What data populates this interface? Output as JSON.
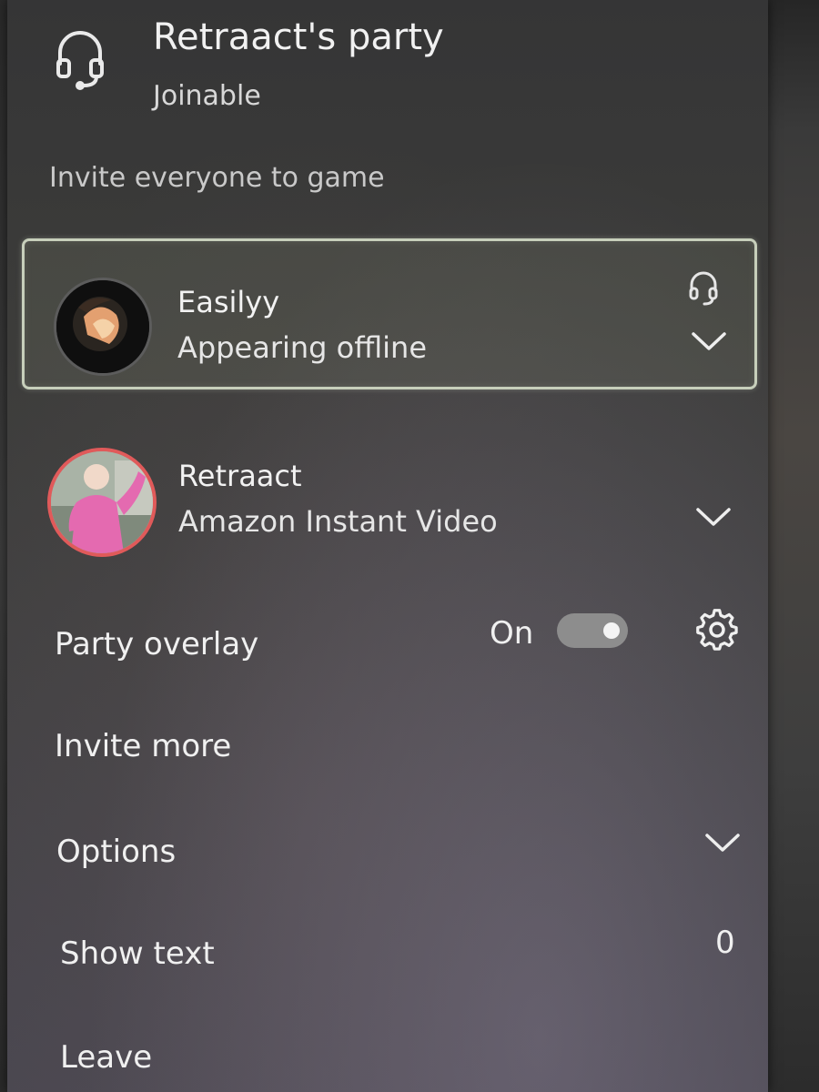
{
  "party": {
    "title": "Retraact's party",
    "subtitle": "Joinable",
    "invite_all_label": "Invite everyone to game"
  },
  "members": [
    {
      "name": "Easilyy",
      "status": "Appearing offline",
      "avatar_icon": "avatar-photo",
      "has_headset": true,
      "selected": true
    },
    {
      "name": "Retraact",
      "status": "Amazon Instant Video",
      "avatar_icon": "avatar-photo",
      "has_headset": false,
      "selected": false
    }
  ],
  "party_overlay": {
    "label": "Party overlay",
    "state_label": "On",
    "enabled": true
  },
  "menu": {
    "invite_more": "Invite more",
    "options": "Options",
    "show_text": "Show text",
    "show_text_count": "0",
    "leave": "Leave"
  },
  "colors": {
    "selection_border": "#c7cfbb",
    "host_ring": "#e05a5a",
    "toggle_track": "#8d8d8d"
  }
}
